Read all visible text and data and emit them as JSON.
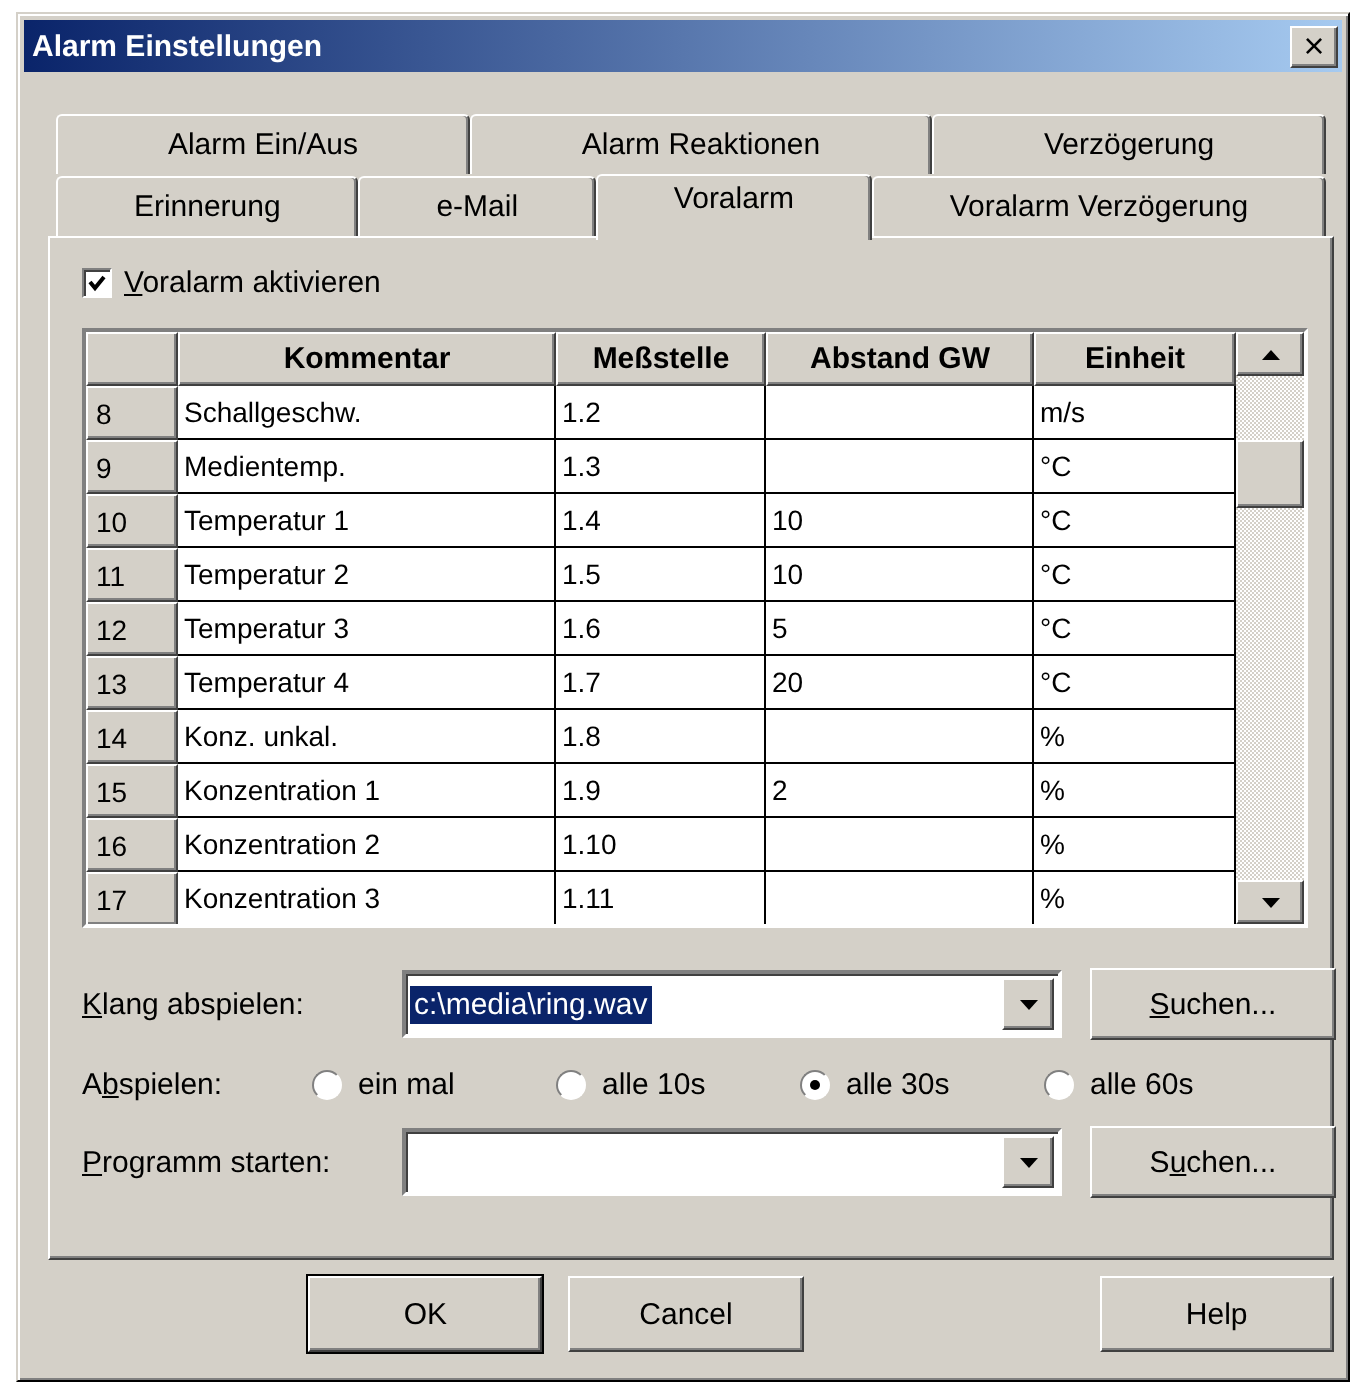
{
  "window": {
    "title": "Alarm Einstellungen",
    "close": "×"
  },
  "tab_rows": [
    [
      {
        "label": "Alarm Ein/Aus",
        "selected": false
      },
      {
        "label": "Alarm Reaktionen",
        "selected": false
      },
      {
        "label": "Verzögerung",
        "selected": false
      }
    ],
    [
      {
        "label": "Erinnerung",
        "selected": false
      },
      {
        "label": "e-Mail",
        "selected": false
      },
      {
        "label": "Voralarm",
        "selected": true
      },
      {
        "label": "Voralarm Verzögerung",
        "selected": false
      }
    ]
  ],
  "activate": {
    "label_parts": {
      "key": "V",
      "after": "oralarm aktivieren"
    },
    "checked": true
  },
  "table": {
    "columns": [
      "Kommentar",
      "Meßstelle",
      "Abstand GW",
      "Einheit"
    ],
    "rows": [
      {
        "index": "8",
        "cells": [
          "Schallgeschw.",
          "1.2",
          "",
          "m/s"
        ]
      },
      {
        "index": "9",
        "cells": [
          "Medientemp.",
          "1.3",
          "",
          "°C"
        ]
      },
      {
        "index": "10",
        "cells": [
          "Temperatur 1",
          "1.4",
          "10",
          "°C"
        ]
      },
      {
        "index": "11",
        "cells": [
          "Temperatur 2",
          "1.5",
          "10",
          "°C"
        ]
      },
      {
        "index": "12",
        "cells": [
          "Temperatur 3",
          "1.6",
          "5",
          "°C"
        ]
      },
      {
        "index": "13",
        "cells": [
          "Temperatur 4",
          "1.7",
          "20",
          "°C"
        ]
      },
      {
        "index": "14",
        "cells": [
          "Konz. unkal.",
          "1.8",
          "",
          "%"
        ]
      },
      {
        "index": "15",
        "cells": [
          "Konzentration 1",
          "1.9",
          "2",
          "%"
        ]
      },
      {
        "index": "16",
        "cells": [
          "Konzentration 2",
          "1.10",
          "",
          "%"
        ]
      },
      {
        "index": "17",
        "cells": [
          "Konzentration 3",
          "1.11",
          "",
          "%"
        ]
      }
    ]
  },
  "sound": {
    "label_parts": {
      "key": "K",
      "after": "lang abspielen:"
    },
    "value": "c:\\media\\ring.wav",
    "button_parts": {
      "key": "S",
      "after": "uchen..."
    }
  },
  "play": {
    "label_parts": {
      "before": "A",
      "key": "b",
      "after": "spielen:"
    },
    "options": [
      {
        "label": "ein mal",
        "selected": false
      },
      {
        "label": "alle 10s",
        "selected": false
      },
      {
        "label": "alle 30s",
        "selected": true
      },
      {
        "label": "alle 60s",
        "selected": false
      }
    ]
  },
  "program": {
    "label_parts": {
      "key": "P",
      "after": "rogramm starten:"
    },
    "button_parts": {
      "before": "S",
      "key": "u",
      "after": "chen..."
    }
  },
  "buttons": [
    "OK",
    "Cancel",
    "Help"
  ]
}
